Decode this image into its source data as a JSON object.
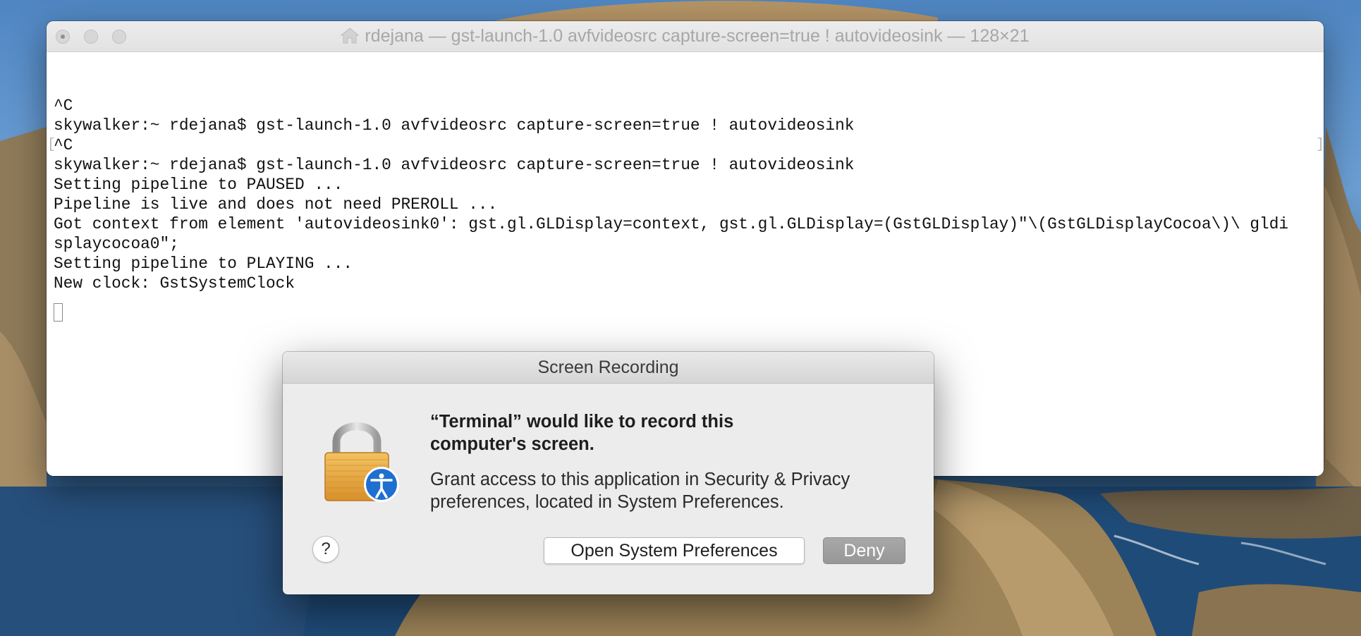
{
  "terminal": {
    "title": "rdejana — gst-launch-1.0 avfvideosrc capture-screen=true ! autovideosink — 128×21",
    "lines": [
      "^C",
      "skywalker:~ rdejana$ gst-launch-1.0 avfvideosrc capture-screen=true ! autovideosink",
      "^C",
      "skywalker:~ rdejana$ gst-launch-1.0 avfvideosrc capture-screen=true ! autovideosink",
      "Setting pipeline to PAUSED ...",
      "Pipeline is live and does not need PREROLL ...",
      "Got context from element 'autovideosink0': gst.gl.GLDisplay=context, gst.gl.GLDisplay=(GstGLDisplay)\"\\(GstGLDisplayCocoa\\)\\ gldi",
      "splaycocoa0\";",
      "Setting pipeline to PLAYING ...",
      "New clock: GstSystemClock"
    ],
    "mark_open": "[",
    "mark_close": "]"
  },
  "dialog": {
    "title": "Screen Recording",
    "heading_line1": "“Terminal” would like to record this",
    "heading_line2": "computer's screen.",
    "body_line1": "Grant access to this application in Security & Privacy",
    "body_line2": "preferences, located in System Preferences.",
    "help_label": "?",
    "open_prefs_label": "Open System Preferences",
    "deny_label": "Deny"
  },
  "icons": {
    "window_title_icon": "home-icon",
    "dialog_icon": "lock-accessibility-icon"
  },
  "colors": {
    "deny_button": "#9d9d9d",
    "accessibility_badge": "#1e6fd0",
    "lock_body": "#e8a93c"
  }
}
